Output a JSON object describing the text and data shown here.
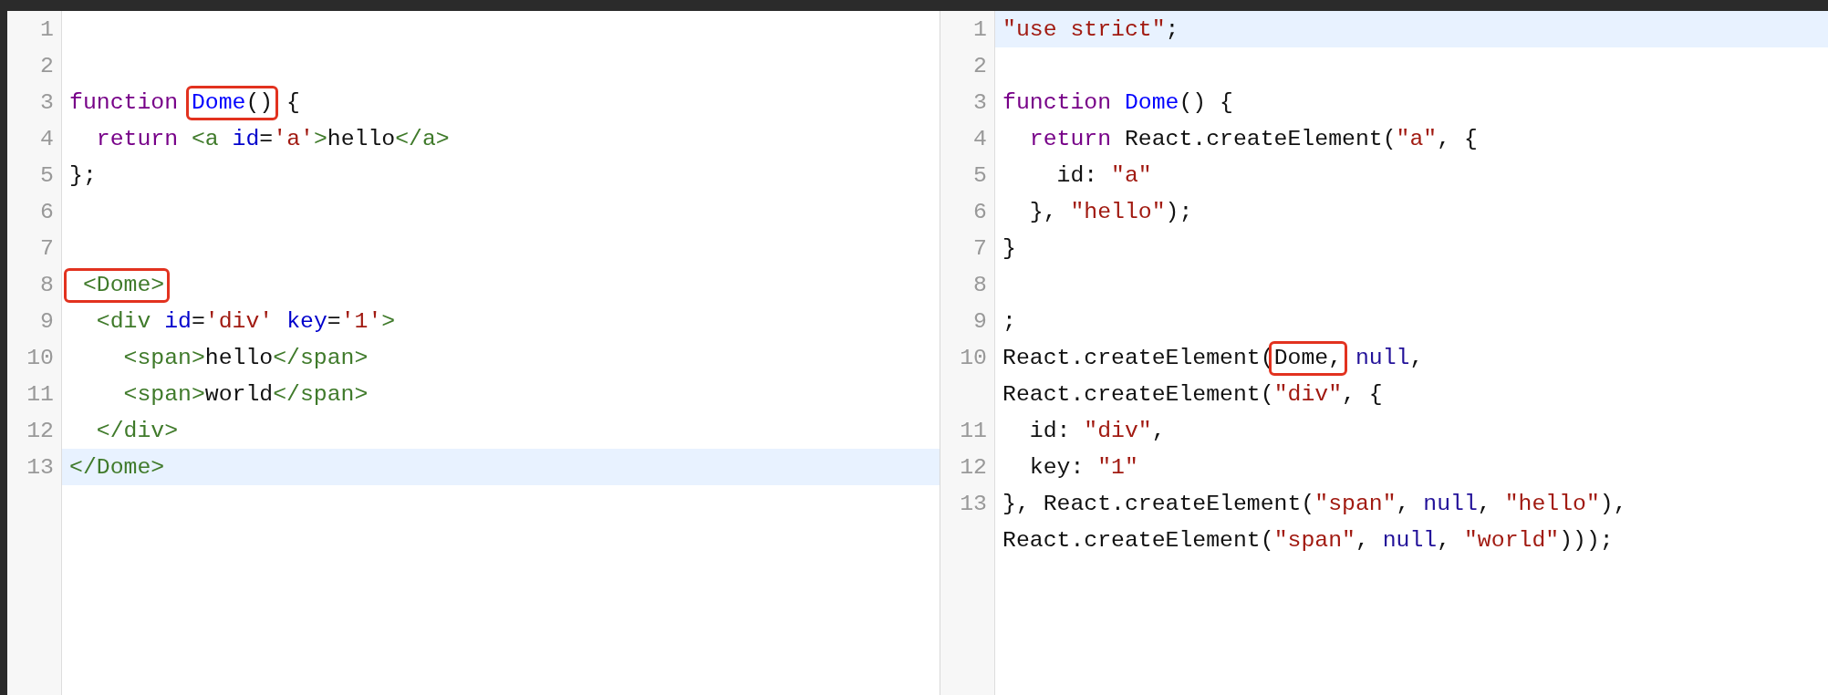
{
  "panels": [
    {
      "lines": [
        {
          "number": "1",
          "active": false
        },
        {
          "number": "2",
          "active": false
        },
        {
          "number": "3",
          "active": false,
          "segments": [
            {
              "kind": "keyword",
              "text": "function "
            },
            {
              "kind": "annotation",
              "segments": [
                {
                  "kind": "def",
                  "text": "Dome"
                },
                {
                  "kind": "plain",
                  "text": "()"
                }
              ]
            },
            {
              "kind": "plain",
              "text": " {"
            }
          ]
        },
        {
          "number": "4",
          "active": false,
          "segments": [
            {
              "kind": "keyword",
              "text": "  return "
            },
            {
              "kind": "tag",
              "text": "<a "
            },
            {
              "kind": "attr",
              "text": "id"
            },
            {
              "kind": "plain",
              "text": "="
            },
            {
              "kind": "string",
              "text": "'a'"
            },
            {
              "kind": "tag",
              "text": ">"
            },
            {
              "kind": "plain",
              "text": "hello"
            },
            {
              "kind": "tag",
              "text": "</a>"
            }
          ]
        },
        {
          "number": "5",
          "active": false,
          "segments": [
            {
              "kind": "plain",
              "text": "};"
            }
          ]
        },
        {
          "number": "6",
          "active": false
        },
        {
          "number": "7",
          "active": false
        },
        {
          "number": "8",
          "active": false,
          "segments": [
            {
              "kind": "annotation",
              "segments": [
                {
                  "kind": "tag",
                  "text": " <Dome>"
                }
              ]
            }
          ]
        },
        {
          "number": "9",
          "active": false,
          "segments": [
            {
              "kind": "tag",
              "text": "  <div "
            },
            {
              "kind": "attr",
              "text": "id"
            },
            {
              "kind": "plain",
              "text": "="
            },
            {
              "kind": "string",
              "text": "'div' "
            },
            {
              "kind": "attr",
              "text": "key"
            },
            {
              "kind": "plain",
              "text": "="
            },
            {
              "kind": "string",
              "text": "'1'"
            },
            {
              "kind": "tag",
              "text": ">"
            }
          ]
        },
        {
          "number": "10",
          "active": false,
          "segments": [
            {
              "kind": "tag",
              "text": "    <span>"
            },
            {
              "kind": "plain",
              "text": "hello"
            },
            {
              "kind": "tag",
              "text": "</span>"
            }
          ]
        },
        {
          "number": "11",
          "active": false,
          "segments": [
            {
              "kind": "tag",
              "text": "    <span>"
            },
            {
              "kind": "plain",
              "text": "world"
            },
            {
              "kind": "tag",
              "text": "</span>"
            }
          ]
        },
        {
          "number": "12",
          "active": false,
          "segments": [
            {
              "kind": "tag",
              "text": "  </div>"
            }
          ]
        },
        {
          "number": "13",
          "active": true,
          "segments": [
            {
              "kind": "tag",
              "text": "</Dome>"
            }
          ]
        }
      ]
    },
    {
      "lines": [
        {
          "number": "1",
          "active": true,
          "segments": [
            {
              "kind": "string",
              "text": "\"use strict\""
            },
            {
              "kind": "plain",
              "text": ";"
            }
          ]
        },
        {
          "number": "2",
          "active": false
        },
        {
          "number": "3",
          "active": false,
          "segments": [
            {
              "kind": "keyword",
              "text": "function "
            },
            {
              "kind": "def",
              "text": "Dome"
            },
            {
              "kind": "plain",
              "text": "() {"
            }
          ]
        },
        {
          "number": "4",
          "active": false,
          "segments": [
            {
              "kind": "keyword",
              "text": "  return"
            },
            {
              "kind": "plain",
              "text": " React.createElement("
            },
            {
              "kind": "string",
              "text": "\"a\""
            },
            {
              "kind": "plain",
              "text": ", {"
            }
          ]
        },
        {
          "number": "5",
          "active": false,
          "segments": [
            {
              "kind": "plain",
              "text": "    id: "
            },
            {
              "kind": "string",
              "text": "\"a\""
            }
          ]
        },
        {
          "number": "6",
          "active": false,
          "segments": [
            {
              "kind": "plain",
              "text": "  }, "
            },
            {
              "kind": "string",
              "text": "\"hello\""
            },
            {
              "kind": "plain",
              "text": ");"
            }
          ]
        },
        {
          "number": "7",
          "active": false,
          "segments": [
            {
              "kind": "plain",
              "text": "}"
            }
          ]
        },
        {
          "number": "8",
          "active": false
        },
        {
          "number": "9",
          "active": false,
          "segments": [
            {
              "kind": "plain",
              "text": ";"
            }
          ]
        },
        {
          "number": "10",
          "active": false,
          "segments": [
            {
              "kind": "plain",
              "text": "React.createElement("
            },
            {
              "kind": "annotation",
              "segments": [
                {
                  "kind": "plain",
                  "text": "Dome,"
                }
              ]
            },
            {
              "kind": "atom",
              "text": " null"
            },
            {
              "kind": "plain",
              "text": ","
            },
            {
              "kind": "break"
            },
            {
              "kind": "plain",
              "text": "React.createElement("
            },
            {
              "kind": "string",
              "text": "\"div\""
            },
            {
              "kind": "plain",
              "text": ", {"
            }
          ]
        },
        {
          "number": "11",
          "active": false,
          "segments": [
            {
              "kind": "plain",
              "text": "  id: "
            },
            {
              "kind": "string",
              "text": "\"div\""
            },
            {
              "kind": "plain",
              "text": ","
            }
          ]
        },
        {
          "number": "12",
          "active": false,
          "segments": [
            {
              "kind": "plain",
              "text": "  key: "
            },
            {
              "kind": "string",
              "text": "\"1\""
            }
          ]
        },
        {
          "number": "13",
          "active": false,
          "segments": [
            {
              "kind": "plain",
              "text": "}, React.createElement("
            },
            {
              "kind": "string",
              "text": "\"span\""
            },
            {
              "kind": "plain",
              "text": ", "
            },
            {
              "kind": "atom",
              "text": "null"
            },
            {
              "kind": "plain",
              "text": ", "
            },
            {
              "kind": "string",
              "text": "\"hello\""
            },
            {
              "kind": "plain",
              "text": "),"
            },
            {
              "kind": "break"
            },
            {
              "kind": "plain",
              "text": "React.createElement("
            },
            {
              "kind": "string",
              "text": "\"span\""
            },
            {
              "kind": "plain",
              "text": ", "
            },
            {
              "kind": "atom",
              "text": "null"
            },
            {
              "kind": "plain",
              "text": ", "
            },
            {
              "kind": "string",
              "text": "\"world\""
            },
            {
              "kind": "plain",
              "text": ")));"
            }
          ]
        }
      ]
    }
  ]
}
